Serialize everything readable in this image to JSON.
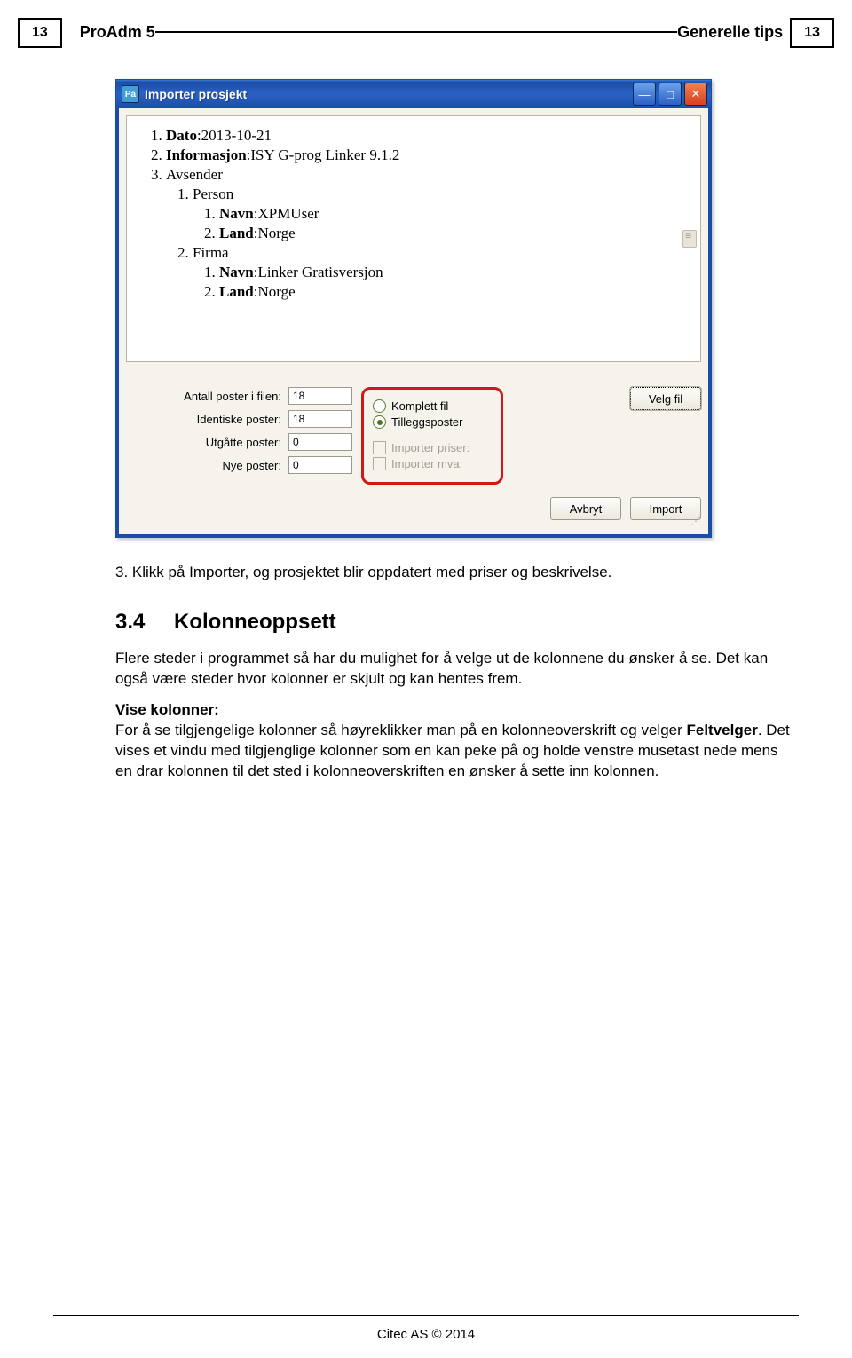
{
  "page": {
    "num_left": "13",
    "title_left": "ProAdm 5",
    "title_right": "Generelle tips",
    "num_right": "13"
  },
  "window": {
    "title": "Importer prosjekt",
    "app_icon": "Pa",
    "tree": {
      "i1_label": "Dato",
      "i1_val": ":2013-10-21",
      "i2_label": "Informasjon",
      "i2_val": ":ISY G-prog Linker 9.1.2",
      "i3_label": "Avsender",
      "i3_1_label": "Person",
      "i3_1_1_label": "Navn",
      "i3_1_1_val": ":XPMUser",
      "i3_1_2_label": "Land",
      "i3_1_2_val": ":Norge",
      "i3_2_label": "Firma",
      "i3_2_1_label": "Navn",
      "i3_2_1_val": ":Linker Gratisversjon",
      "i3_2_2_label": "Land",
      "i3_2_2_val": ":Norge"
    },
    "fields": {
      "antall_label": "Antall poster i filen:",
      "antall_val": "18",
      "identiske_label": "Identiske poster:",
      "identiske_val": "18",
      "utgatte_label": "Utgåtte poster:",
      "utgatte_val": "0",
      "nye_label": "Nye poster:",
      "nye_val": "0"
    },
    "radios": {
      "komplett": "Komplett fil",
      "tillegg": "Tilleggsposter"
    },
    "checks": {
      "priser": "Importer  priser:",
      "mva": "Importer  mva:"
    },
    "buttons": {
      "velg": "Velg fil",
      "avbryt": "Avbryt",
      "import": "Import"
    }
  },
  "body": {
    "step3": "3. Klikk på Importer, og prosjektet blir oppdatert med priser og beskrivelse.",
    "sec_num": "3.4",
    "sec_title": "Kolonneoppsett",
    "p1": "Flere steder i programmet så har du mulighet for å velge ut de kolonnene du ønsker å se. Det kan også være steder hvor kolonner er skjult og kan hentes frem.",
    "sub1": "Vise kolonner:",
    "p2a": "For å se tilgjengelige kolonner så høyreklikker man på en kolonneoverskrift og velger ",
    "p2b": "Feltvelger",
    "p2c": ". Det vises et vindu med tilgjenglige kolonner som en kan peke på og holde venstre musetast nede mens en drar kolonnen til det sted i kolonneoverskriften en ønsker å sette inn kolonnen."
  },
  "footer": "Citec AS © 2014"
}
